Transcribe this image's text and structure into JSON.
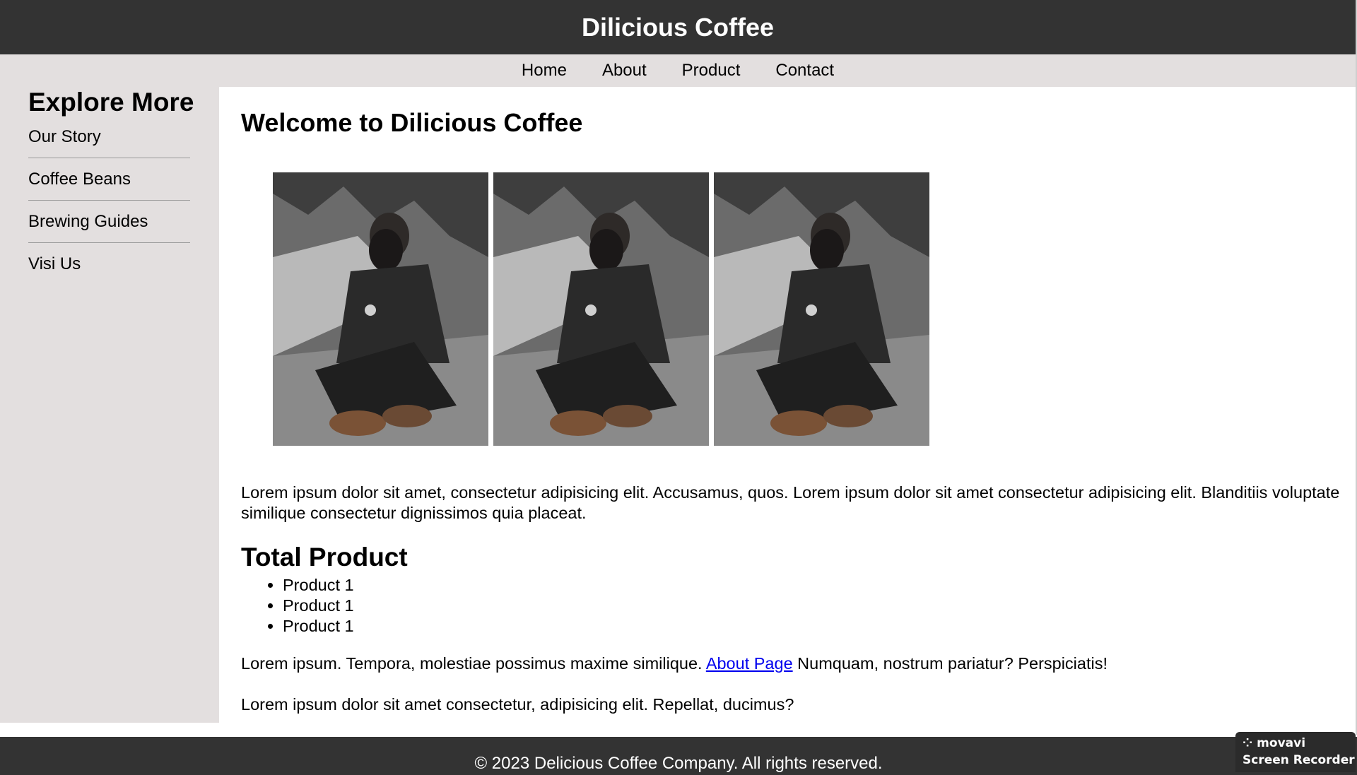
{
  "header": {
    "title": "Dilicious Coffee"
  },
  "nav": {
    "items": [
      "Home",
      "About",
      "Product",
      "Contact"
    ]
  },
  "sidebar": {
    "title": "Explore More",
    "items": [
      "Our Story",
      "Coffee Beans",
      "Brewing Guides",
      "Visi Us"
    ]
  },
  "main": {
    "welcome_title": "Welcome to Dilicious Coffee",
    "gallery_count": 3,
    "intro_paragraph": "Lorem ipsum dolor sit amet, consectetur adipisicing elit. Accusamus, quos. Lorem ipsum dolor sit amet consectetur adipisicing elit. Blanditiis voluptate similique consectetur dignissimos quia placeat.",
    "total_title": "Total Product",
    "products": [
      "Product 1",
      "Product 1",
      "Product 1"
    ],
    "para2_before": "Lorem ipsum. Tempora, molestiae possimus maxime similique. ",
    "para2_link": "About Page",
    "para2_after": " Numquam, nostrum pariatur? Perspiciatis!",
    "para3": "Lorem ipsum dolor sit amet consectetur, adipisicing elit. Repellat, ducimus?"
  },
  "footer": {
    "text": "© 2023 Delicious Coffee Company. All rights reserved."
  },
  "watermark": {
    "brand": "movavi",
    "subtitle": "Screen Recorder"
  },
  "colors": {
    "header_bg": "#333333",
    "nav_bg": "#e3dfdf",
    "link": "#0000ee"
  }
}
